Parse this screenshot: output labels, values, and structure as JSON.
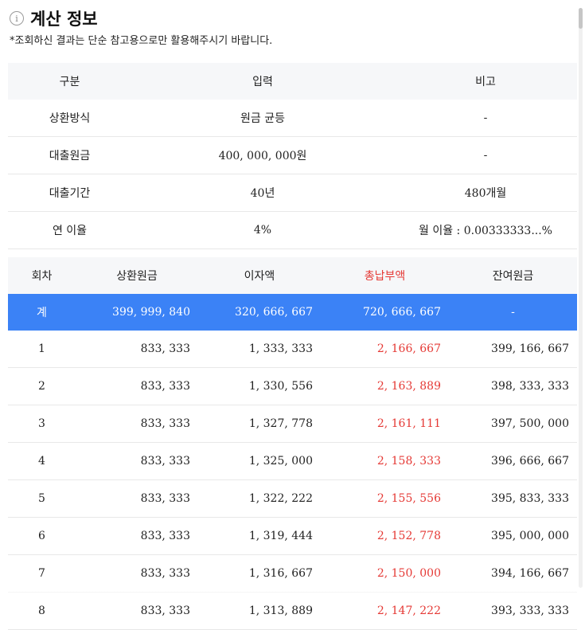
{
  "header": {
    "icon": "info-icon",
    "icon_glyph": "i",
    "title": "계산 정보",
    "note": "*조회하신 결과는 단순 참고용으로만 활용해주시기 바랍니다."
  },
  "info_table": {
    "columns": [
      "구분",
      "입력",
      "비고"
    ],
    "rows": [
      [
        "상환방식",
        "원금 균등",
        "-"
      ],
      [
        "대출원금",
        "400, 000, 000원",
        "-"
      ],
      [
        "대출기간",
        "40년",
        "480개월"
      ],
      [
        "연 이율",
        "4%",
        "월 이율 : 0.00333333...%"
      ]
    ]
  },
  "schedule_table": {
    "columns": [
      "회차",
      "상환원금",
      "이자액",
      "총납부액",
      "잔여원금"
    ],
    "highlight_color": "#e53935",
    "total_row_color": "#3b82f6",
    "total": [
      "계",
      "399, 999, 840",
      "320, 666, 667",
      "720, 666, 667",
      "-"
    ],
    "rows": [
      [
        "1",
        "833, 333",
        "1, 333, 333",
        "2, 166, 667",
        "399, 166, 667"
      ],
      [
        "2",
        "833, 333",
        "1, 330, 556",
        "2, 163, 889",
        "398, 333, 333"
      ],
      [
        "3",
        "833, 333",
        "1, 327, 778",
        "2, 161, 111",
        "397, 500, 000"
      ],
      [
        "4",
        "833, 333",
        "1, 325, 000",
        "2, 158, 333",
        "396, 666, 667"
      ],
      [
        "5",
        "833, 333",
        "1, 322, 222",
        "2, 155, 556",
        "395, 833, 333"
      ],
      [
        "6",
        "833, 333",
        "1, 319, 444",
        "2, 152, 778",
        "395, 000, 000"
      ],
      [
        "7",
        "833, 333",
        "1, 316, 667",
        "2, 150, 000",
        "394, 166, 667"
      ],
      [
        "8",
        "833, 333",
        "1, 313, 889",
        "2, 147, 222",
        "393, 333, 333"
      ]
    ]
  }
}
